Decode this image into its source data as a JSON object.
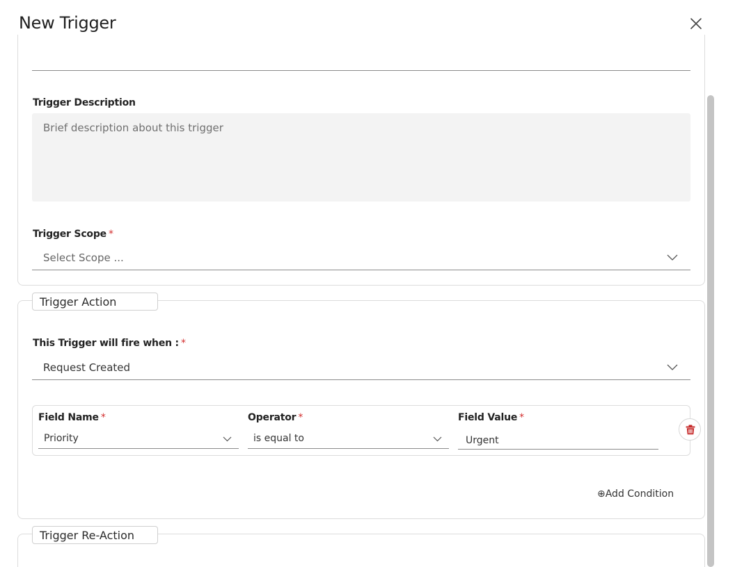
{
  "dialog": {
    "title": "New Trigger"
  },
  "trigger_description": {
    "label": "Trigger Description",
    "placeholder": "Brief description about this trigger"
  },
  "trigger_scope": {
    "label": "Trigger Scope",
    "required_mark": "*",
    "placeholder": "Select Scope ..."
  },
  "trigger_action": {
    "legend": "Trigger Action",
    "fire_when": {
      "label": "This Trigger will fire when :",
      "required_mark": "*",
      "value": "Request Created"
    },
    "condition": {
      "field_name": {
        "label": "Field Name",
        "required_mark": "*",
        "value": "Priority"
      },
      "operator": {
        "label": "Operator",
        "required_mark": "*",
        "value": "is equal to"
      },
      "field_value": {
        "label": "Field Value",
        "required_mark": "*",
        "value": "Urgent"
      }
    },
    "add_condition_label": "⊕Add Condition"
  },
  "trigger_reaction": {
    "legend": "Trigger Re-Action"
  },
  "colors": {
    "required": "#d32f2f",
    "delete_icon": "#c62828",
    "input_bg": "#f3f3f3"
  },
  "icons": {
    "close": "close-icon",
    "chevron": "chevron-down-icon",
    "delete": "trash-icon"
  }
}
